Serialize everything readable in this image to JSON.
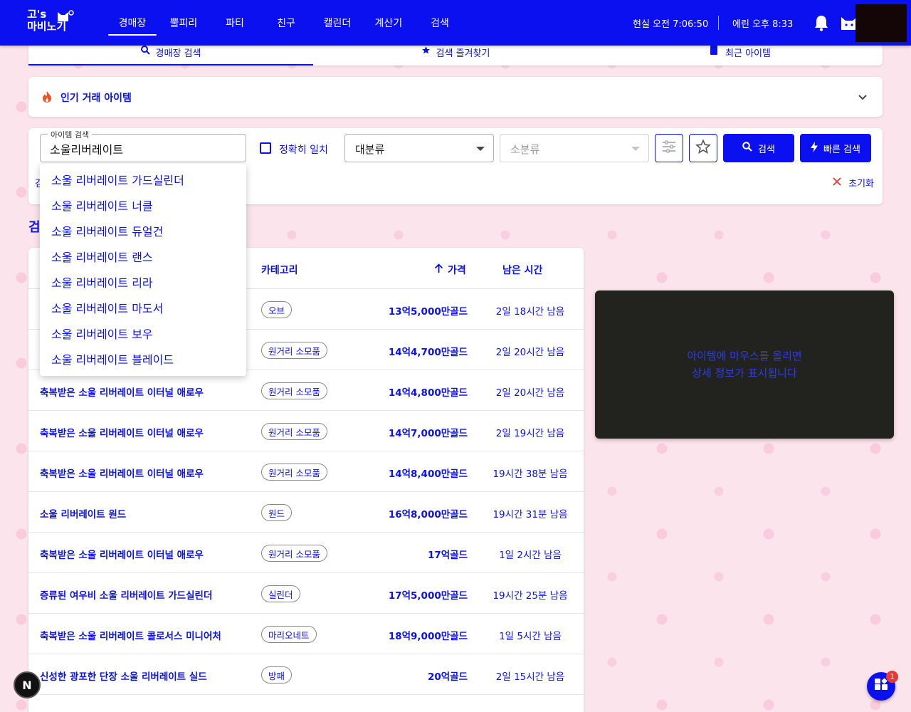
{
  "header": {
    "logo_line1": "고's",
    "logo_line2": "마비노기",
    "nav": [
      {
        "label": "경매장",
        "active": true
      },
      {
        "label": "뿔피리",
        "active": false
      },
      {
        "label": "파티",
        "active": false
      },
      {
        "label": "친구",
        "active": false
      },
      {
        "label": "캘린더",
        "active": false
      },
      {
        "label": "계산기",
        "active": false
      },
      {
        "label": "검색",
        "active": false
      }
    ],
    "real_time": "현실 오전 7:06:50",
    "erinn_time": "에린 오후 8:33"
  },
  "tabs": [
    {
      "label": "경매장 검색",
      "icon": "search-icon",
      "active": true
    },
    {
      "label": "검색 즐겨찾기",
      "icon": "star-icon",
      "active": false
    },
    {
      "label": "최근 아이템",
      "icon": "bookmark-icon",
      "active": false
    }
  ],
  "hot_items": {
    "title": "인기 거래 아이템"
  },
  "search": {
    "input_label": "아이템 검색",
    "input_value": "소울리버레이트",
    "exact_match_label": "정확히 일치",
    "category_major": "대분류",
    "category_minor_placeholder": "소분류",
    "search_button": "검색",
    "quick_search_button": "빠른 검색",
    "reset_label": "초기화",
    "clipped_left_label": "검"
  },
  "autocomplete": [
    "소울 리버레이트 가드실린더",
    "소울 리버레이트 너클",
    "소울 리버레이트 듀얼건",
    "소울 리버레이트 랜스",
    "소울 리버레이트 리라",
    "소울 리버레이트 마도서",
    "소울 리버레이트 보우",
    "소울 리버레이트 블레이드"
  ],
  "results": {
    "heading": "검",
    "columns": {
      "category": "카테고리",
      "price": "가격",
      "time": "남은 시간"
    },
    "rows": [
      {
        "name": "",
        "category": "오브",
        "price": "13억5,000만골드",
        "time": "2일 18시간 남음"
      },
      {
        "name": "",
        "category": "원거리 소모품",
        "price": "14억4,700만골드",
        "time": "2일 20시간 남음"
      },
      {
        "name": "축복받은 소울 리버레이트 이터널 애로우",
        "category": "원거리 소모품",
        "price": "14억4,800만골드",
        "time": "2일 20시간 남음"
      },
      {
        "name": "축복받은 소울 리버레이트 이터널 애로우",
        "category": "원거리 소모품",
        "price": "14억7,000만골드",
        "time": "2일 19시간 남음"
      },
      {
        "name": "축복받은 소울 리버레이트 이터널 애로우",
        "category": "원거리 소모품",
        "price": "14억8,400만골드",
        "time": "19시간 38분 남음"
      },
      {
        "name": "소울 리버레이트 원드",
        "category": "원드",
        "price": "16억8,000만골드",
        "time": "19시간 31분 남음"
      },
      {
        "name": "축복받은 소울 리버레이트 이터널 애로우",
        "category": "원거리 소모품",
        "price": "17억골드",
        "time": "1일 2시간 남음"
      },
      {
        "name": "증류된 여우비 소울 리버레이트 가드실린더",
        "category": "실린더",
        "price": "17억5,000만골드",
        "time": "19시간 25분 남음"
      },
      {
        "name": "축복받은 소울 리버레이트 콜로서스 미니어처",
        "category": "마리오네트",
        "price": "18억9,000만골드",
        "time": "1일 5시간 남음"
      },
      {
        "name": "신성한 광포한 단장 소울 리버레이트 실드",
        "category": "방패",
        "price": "20억골드",
        "time": "2일 15시간 남음"
      }
    ]
  },
  "detail_panel": {
    "line1": "아이템에 마우스를 올리면",
    "line2": "상세 정보가 표시됩니다"
  },
  "floating": {
    "n_label": "N",
    "apps_badge": "1"
  },
  "colors": {
    "primary": "#0a10f0",
    "background": "#fce4ec",
    "panel_dark": "#22221f",
    "badge": "#e53935"
  }
}
